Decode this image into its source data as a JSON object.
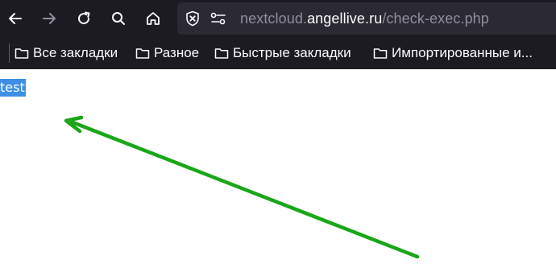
{
  "toolbar": {
    "back_icon": "back-arrow-icon",
    "forward_icon": "forward-arrow-icon",
    "reload_icon": "reload-icon",
    "search_icon": "search-icon",
    "home_icon": "home-icon"
  },
  "urlbar": {
    "security_icon": "shield-blocked-icon",
    "permissions_icon": "permissions-icon",
    "prefix": "nextcloud.",
    "domain": "angellive.ru",
    "path": "/check-exec.php"
  },
  "bookmarks": {
    "items": [
      {
        "label": "Все закладки",
        "icon": "folder-icon"
      },
      {
        "label": "Разное",
        "icon": "folder-icon"
      },
      {
        "label": "Быстрые закладки",
        "icon": "folder-icon"
      },
      {
        "label": "Импортированные и...",
        "icon": "folder-icon"
      }
    ]
  },
  "page": {
    "selected_text": "test"
  },
  "annotation": {
    "arrow_color": "#1aa619"
  },
  "colors": {
    "chrome_bg": "#1c1b22",
    "urlbar_bg": "#2b2a33",
    "selection": "#3d8fe6"
  }
}
